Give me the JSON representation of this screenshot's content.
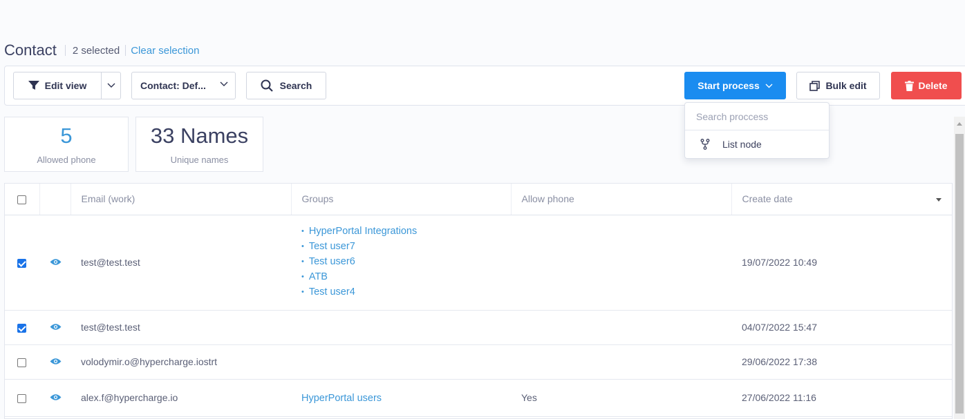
{
  "header": {
    "title": "Contact",
    "selected_text": "2 selected",
    "clear_selection": "Clear selection"
  },
  "toolbar": {
    "edit_view": "Edit view",
    "contact_view": "Contact: Def...",
    "search": "Search",
    "start_process": "Start process",
    "bulk_edit": "Bulk edit",
    "delete": "Delete"
  },
  "dropdown": {
    "search_placeholder": "Search proccess",
    "items": [
      {
        "label": "List node",
        "icon": "fork-icon"
      }
    ]
  },
  "stats": [
    {
      "value": "5",
      "label": "Allowed phone"
    },
    {
      "value": "33 Names",
      "label": "Unique names"
    }
  ],
  "table": {
    "columns": [
      "Email (work)",
      "Groups",
      "Allow phone",
      "Create date"
    ],
    "rows": [
      {
        "checked": true,
        "email": "test@test.test",
        "groups": [
          "HyperPortal Integrations",
          "Test user7",
          "Test user6",
          "ATB",
          "Test user4"
        ],
        "allow_phone": "",
        "create_date": "19/07/2022 10:49"
      },
      {
        "checked": true,
        "email": "test@test.test",
        "groups": [],
        "allow_phone": "",
        "create_date": "04/07/2022 15:47"
      },
      {
        "checked": false,
        "email": "volodymir.o@hypercharge.iostrt",
        "groups": [],
        "allow_phone": "",
        "create_date": "29/06/2022 17:38"
      },
      {
        "checked": false,
        "email": "alex.f@hypercharge.io",
        "groups_link": "HyperPortal users",
        "allow_phone": "Yes",
        "create_date": "27/06/2022 11:16"
      }
    ]
  },
  "colors": {
    "primary": "#1a8cf0",
    "danger": "#f04e4e",
    "link": "#3b97d8"
  }
}
